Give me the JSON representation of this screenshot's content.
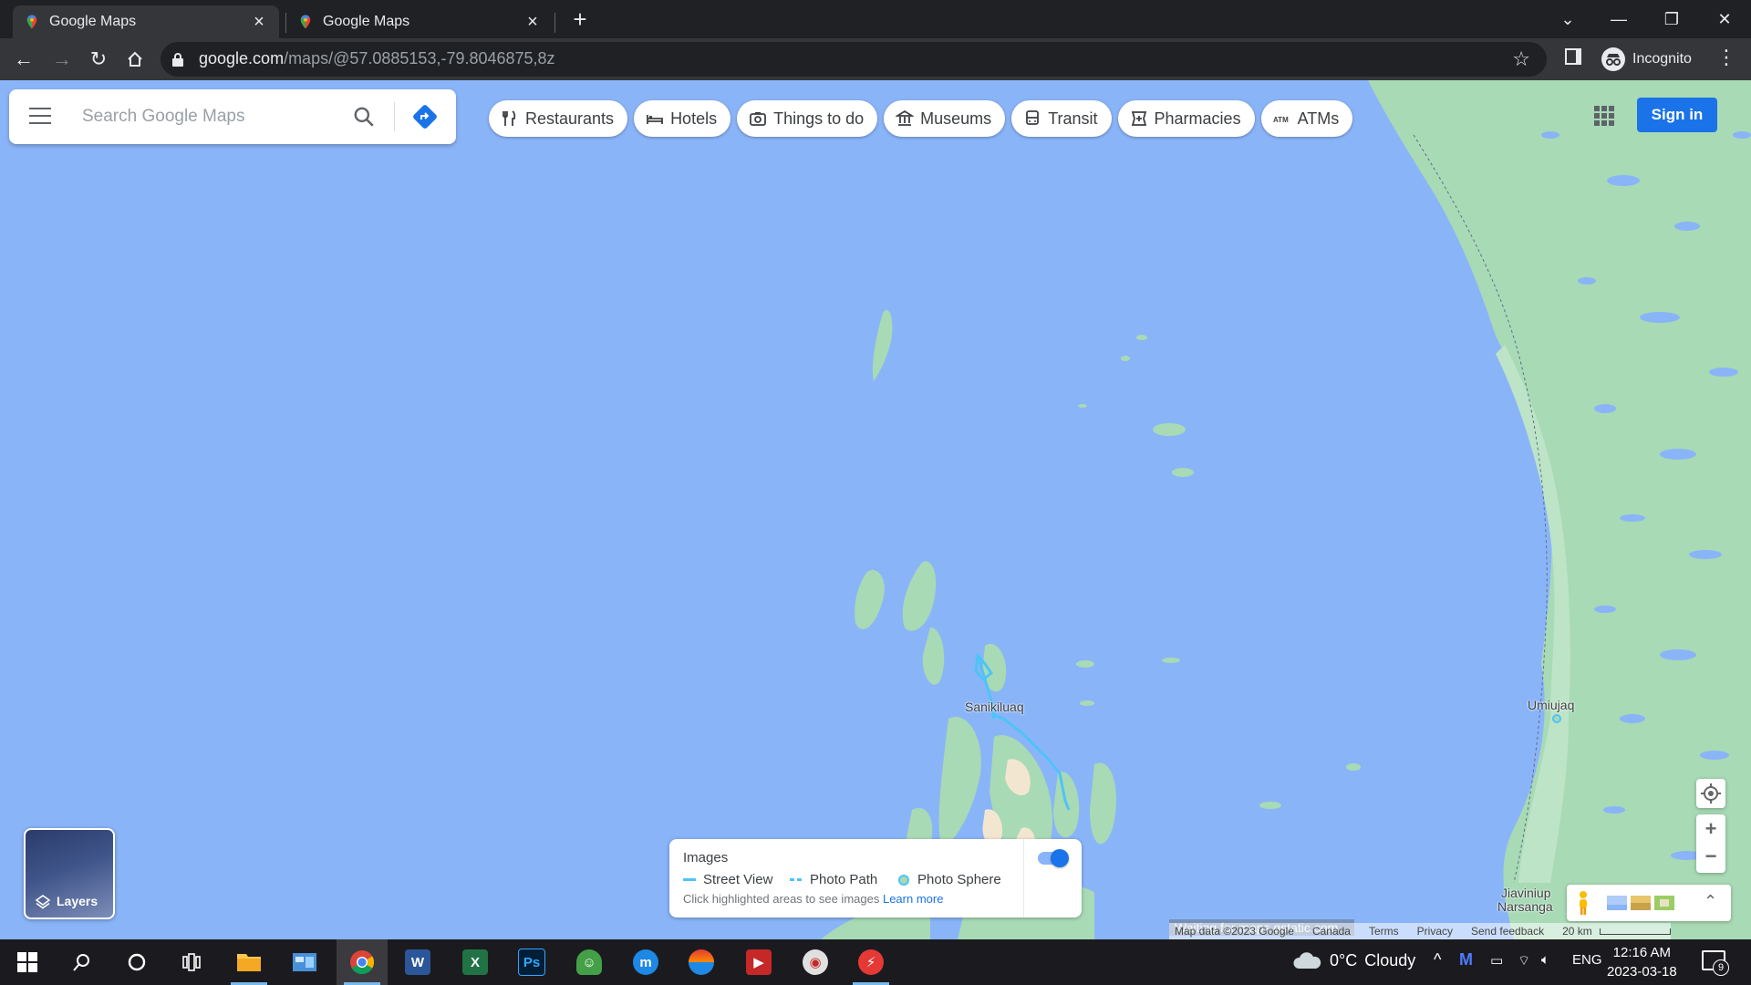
{
  "browser": {
    "tabs": [
      {
        "title": "Google Maps",
        "active": true
      },
      {
        "title": "Google Maps",
        "active": false
      }
    ],
    "url_host": "google.com",
    "url_path": "/maps/@57.0885153,-79.8046875,8z",
    "profile_label": "Incognito"
  },
  "maps": {
    "search_placeholder": "Search Google Maps",
    "chips": [
      {
        "label": "Restaurants",
        "icon": "fork-knife-icon"
      },
      {
        "label": "Hotels",
        "icon": "bed-icon"
      },
      {
        "label": "Things to do",
        "icon": "camera-icon"
      },
      {
        "label": "Museums",
        "icon": "museum-icon"
      },
      {
        "label": "Transit",
        "icon": "bus-icon"
      },
      {
        "label": "Pharmacies",
        "icon": "pharmacy-icon"
      },
      {
        "label": "ATMs",
        "icon": "atm-icon"
      }
    ],
    "sign_in_label": "Sign in",
    "places": [
      {
        "label": "Sanikiluaq"
      },
      {
        "label": "Umiujaq"
      },
      {
        "label": "Jiaviniup"
      },
      {
        "label": "Narsanga"
      }
    ],
    "layers_label": "Layers",
    "images_panel": {
      "title": "Images",
      "legend": [
        "Street View",
        "Photo Path",
        "Photo Sphere"
      ],
      "hint": "Click highlighted areas to see images",
      "learn_more": "Learn more",
      "toggle_on": true
    },
    "attribution": {
      "waiting": "Waiting for maps.gstatic.com...",
      "map_data": "Map data ©2023 Google",
      "country": "Canada",
      "terms": "Terms",
      "privacy": "Privacy",
      "feedback": "Send feedback",
      "scale": "20 km"
    },
    "colors": {
      "water": "#8ab4f8",
      "land": "#a8dab5",
      "accent": "#1a73e8",
      "street_view_line": "#4fc3f7"
    }
  },
  "taskbar": {
    "weather_temp": "0°C",
    "weather_desc": "Cloudy",
    "language": "ENG",
    "time": "12:16 AM",
    "date": "2023-03-18",
    "notification_count": "9"
  }
}
